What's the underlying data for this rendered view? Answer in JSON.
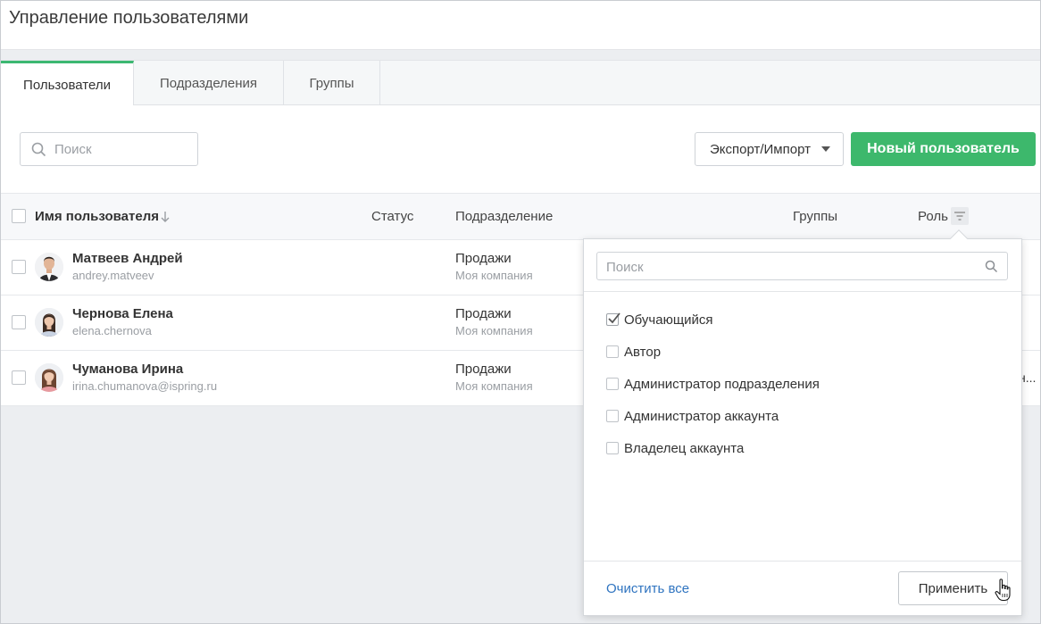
{
  "page": {
    "title": "Управление пользователями"
  },
  "tabs": [
    {
      "label": "Пользователи",
      "active": true
    },
    {
      "label": "Подразделения",
      "active": false
    },
    {
      "label": "Группы",
      "active": false
    }
  ],
  "toolbar": {
    "search_placeholder": "Поиск",
    "export_label": "Экспорт/Импорт",
    "new_user_label": "Новый пользователь"
  },
  "table": {
    "columns": {
      "name": "Имя пользователя",
      "status": "Статус",
      "department": "Подразделение",
      "groups": "Группы",
      "role": "Роль"
    },
    "rows": [
      {
        "name": "Матвеев Андрей",
        "login": "andrey.matveev",
        "department": "Продажи",
        "company": "Моя компания",
        "trailing": ""
      },
      {
        "name": "Чернова Елена",
        "login": "elena.chernova",
        "department": "Продажи",
        "company": "Моя компания",
        "trailing": ""
      },
      {
        "name": "Чуманова Ирина",
        "login": "irina.chumanova@ispring.ru",
        "department": "Продажи",
        "company": "Моя компания",
        "trailing": "н..."
      }
    ]
  },
  "role_filter": {
    "search_placeholder": "Поиск",
    "options": [
      {
        "label": "Обучающийся",
        "checked": true
      },
      {
        "label": "Автор",
        "checked": false
      },
      {
        "label": "Администратор подразделения",
        "checked": false
      },
      {
        "label": "Администратор аккаунта",
        "checked": false
      },
      {
        "label": "Владелец аккаунта",
        "checked": false
      }
    ],
    "clear_label": "Очистить все",
    "apply_label": "Применить"
  },
  "colors": {
    "accent_green": "#3db86c",
    "link_blue": "#2f74c0"
  }
}
